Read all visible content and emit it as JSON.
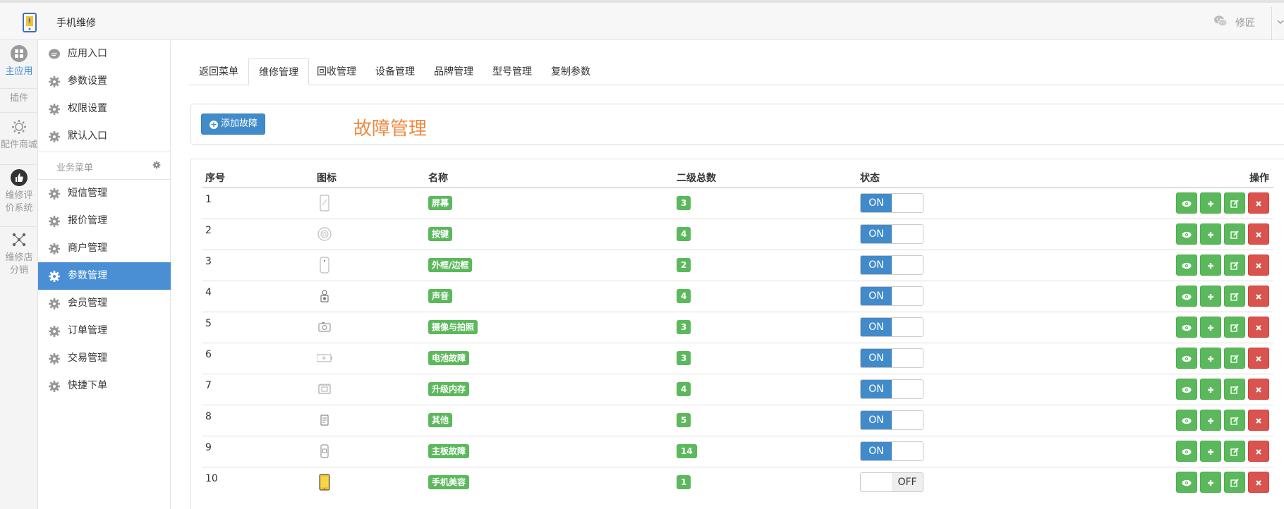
{
  "header": {
    "title": "手机维修",
    "user": "修匠"
  },
  "plugins": [
    {
      "label": "主应用",
      "icon": "grid-circle-icon",
      "active": true
    },
    {
      "label": "插件",
      "icon": "",
      "active": false
    },
    {
      "label": "配件商城",
      "icon": "gear-outline-icon",
      "active": false
    },
    {
      "label": "维修评价系统",
      "icon": "thumbs-up-icon",
      "active": false
    },
    {
      "label": "维修店分销",
      "icon": "share-nodes-icon",
      "active": false
    }
  ],
  "menu": {
    "top_items": [
      "应用入口",
      "参数设置",
      "权限设置",
      "默认入口"
    ],
    "group_title": "业务菜单",
    "items": [
      "短信管理",
      "报价管理",
      "商户管理",
      "参数管理",
      "会员管理",
      "订单管理",
      "交易管理",
      "快捷下单"
    ],
    "active_item": "参数管理"
  },
  "tabs": [
    "返回菜单",
    "维修管理",
    "回收管理",
    "设备管理",
    "品牌管理",
    "型号管理",
    "复制参数"
  ],
  "active_tab": "维修管理",
  "panel": {
    "add_button": "添加故障",
    "title": "故障管理"
  },
  "table": {
    "headers": {
      "index": "序号",
      "icon": "图标",
      "name": "名称",
      "count": "二级总数",
      "status": "状态",
      "ops": "操作"
    },
    "rows": [
      {
        "index": "1",
        "icon": "phone-screen-icon",
        "name": "屏幕",
        "count": "3",
        "status": "ON"
      },
      {
        "index": "2",
        "icon": "home-button-icon",
        "name": "按键",
        "count": "4",
        "status": "ON"
      },
      {
        "index": "3",
        "icon": "phone-frame-icon",
        "name": "外框/边框",
        "count": "2",
        "status": "ON"
      },
      {
        "index": "4",
        "icon": "speaker-icon",
        "name": "声音",
        "count": "4",
        "status": "ON"
      },
      {
        "index": "5",
        "icon": "camera-icon",
        "name": "摄像与拍照",
        "count": "3",
        "status": "ON"
      },
      {
        "index": "6",
        "icon": "battery-icon",
        "name": "电池故障",
        "count": "3",
        "status": "ON"
      },
      {
        "index": "7",
        "icon": "memory-chip-icon",
        "name": "升级内存",
        "count": "4",
        "status": "ON"
      },
      {
        "index": "8",
        "icon": "other-device-icon",
        "name": "其他",
        "count": "5",
        "status": "ON"
      },
      {
        "index": "9",
        "icon": "mainboard-icon",
        "name": "主板故障",
        "count": "14",
        "status": "ON"
      },
      {
        "index": "10",
        "icon": "phone-beauty-icon",
        "name": "手机美容",
        "count": "1",
        "status": "OFF"
      }
    ]
  },
  "colors": {
    "primary": "#428bca",
    "success": "#5cb85c",
    "danger": "#d9534f",
    "title_orange": "#f0883e"
  }
}
